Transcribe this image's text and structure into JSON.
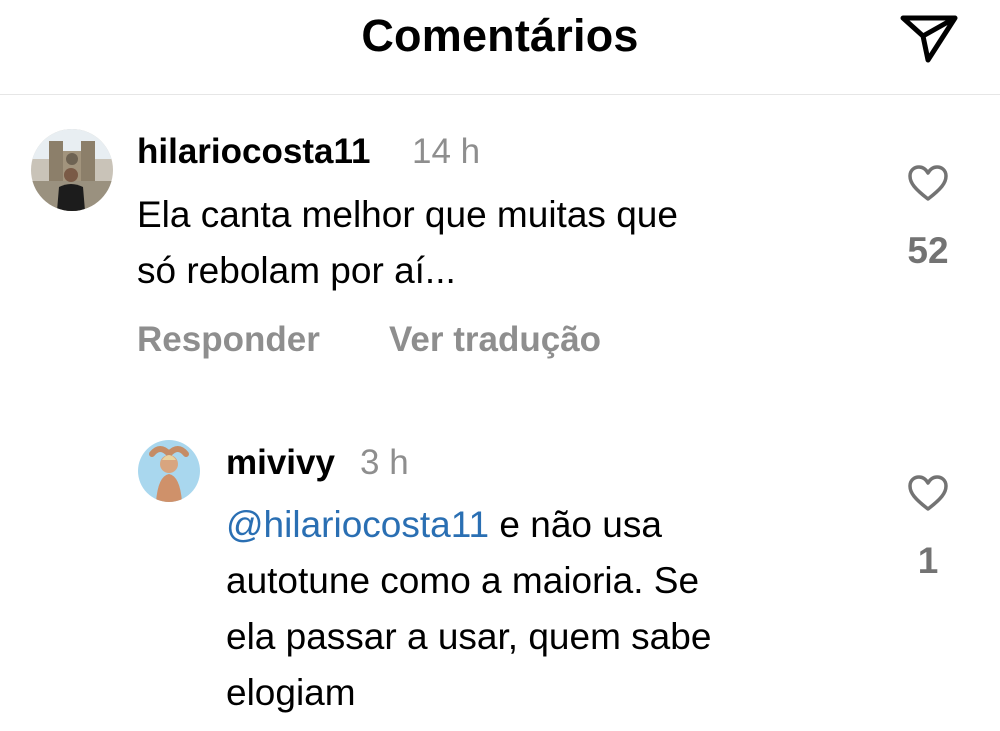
{
  "header": {
    "title": "Comentários",
    "share_icon": "paper-plane-icon"
  },
  "comments": [
    {
      "username": "hilariocosta11",
      "time": "14 h",
      "text_lines": [
        "Ela canta melhor que muitas que",
        "só rebolam por aí..."
      ],
      "likes": "52",
      "actions": {
        "reply": "Responder",
        "translate": "Ver tradução"
      }
    }
  ],
  "replies": [
    {
      "username": "mivivy",
      "time": "3 h",
      "mention": "@hilariocosta11",
      "line1_rest": " e não usa",
      "text_lines": [
        "autotune  como a maioria. Se",
        "ela passar a usar, quem sabe",
        "elogiam"
      ],
      "likes": "1"
    }
  ],
  "colors": {
    "mention": "#2a6fb3",
    "muted": "#8e8e8e"
  }
}
